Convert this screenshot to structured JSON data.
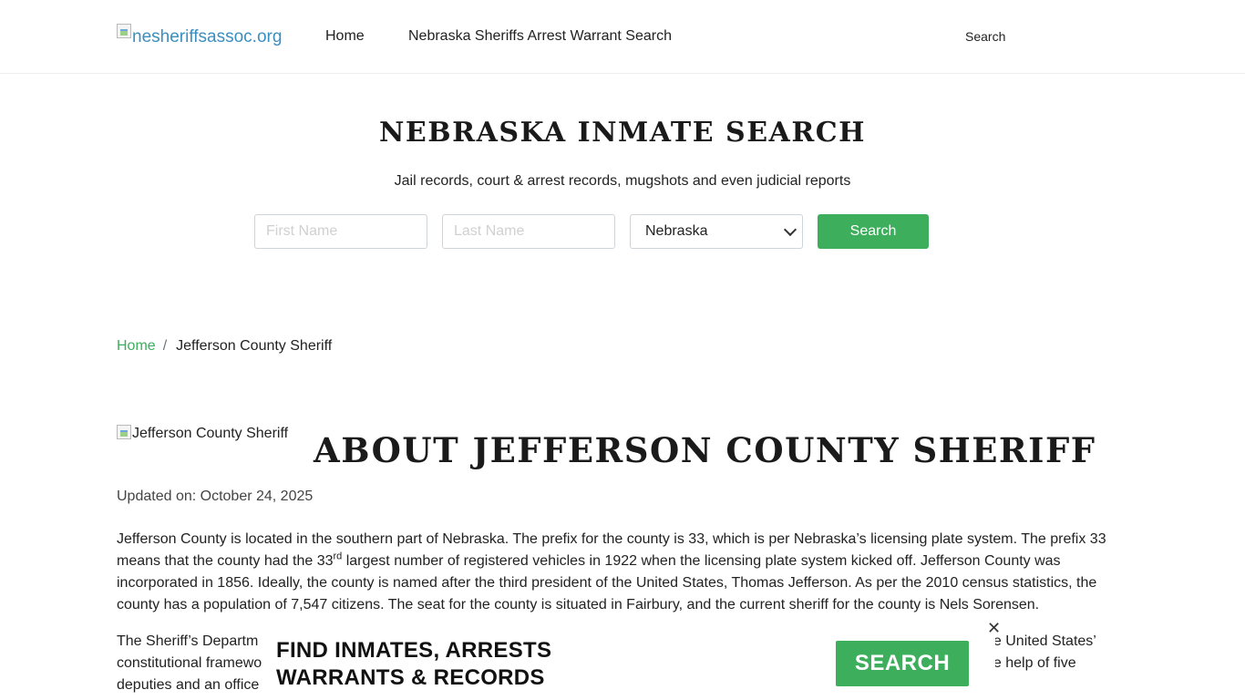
{
  "header": {
    "logo_alt": "nesheriffsassoc.org",
    "nav": {
      "home": "Home",
      "warrant_search": "Nebraska Sheriffs Arrest Warrant Search"
    },
    "search_link": "Search"
  },
  "hero": {
    "title": "NEBRASKA INMATE SEARCH",
    "subtitle": "Jail records, court & arrest records, mugshots and even judicial reports",
    "first_name_placeholder": "First Name",
    "last_name_placeholder": "Last Name",
    "state_selected": "Nebraska",
    "search_button": "Search"
  },
  "breadcrumb": {
    "home": "Home",
    "separator": "/",
    "current": "Jefferson County Sheriff"
  },
  "about": {
    "image_alt": "Jefferson County Sheriff",
    "title": "ABOUT JEFFERSON COUNTY SHERIFF",
    "updated": "Updated on: October 24, 2025",
    "p1_a": "Jefferson County is located in the southern part of Nebraska. The prefix for the county is 33, which is per Nebraska’s licensing plate system. The prefix 33 means that the county had the 33",
    "p1_sup": "rd",
    "p1_b": " largest number of registered vehicles in 1922 when the licensing plate system kicked off. Jefferson County was incorporated in 1856. Ideally, the county is named after the third president of the United States, Thomas Jefferson. As per the 2010 census statistics, the county has a population of 7,547 citizens. The seat for the county is situated in Fairbury, and the current sheriff for the county is Nels Sorensen.",
    "p2_line1_start": "The Sheriff’s Departm",
    "p2_line1_end": "he United States’",
    "p2_line2_start": "constitutional framewo",
    "p2_line2_end": "he help of five",
    "p2_line3_start": "deputies and an office"
  },
  "banner": {
    "line1": "FIND INMATES, ARRESTS",
    "line2": "WARRANTS & RECORDS",
    "button": "SEARCH",
    "close": "✕"
  },
  "colors": {
    "accent_green": "#3cae5c",
    "logo_blue": "#3b8fc0"
  }
}
